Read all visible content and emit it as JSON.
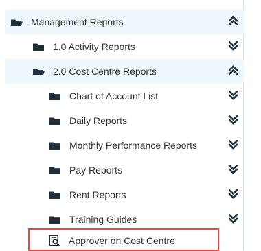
{
  "tree": {
    "root": {
      "label": "Management Reports",
      "expanded": true,
      "icon": "folder-open-icon"
    },
    "children": [
      {
        "label": "1.0 Activity Reports",
        "expanded": false,
        "icon": "folder-icon"
      },
      {
        "label": "2.0 Cost Centre Reports",
        "expanded": true,
        "icon": "folder-open-icon",
        "children": [
          {
            "label": "Chart of Account List",
            "icon": "folder-icon",
            "expanded": false
          },
          {
            "label": "Daily Reports",
            "icon": "folder-icon",
            "expanded": false
          },
          {
            "label": "Monthly Performance Reports",
            "icon": "folder-icon",
            "expanded": false
          },
          {
            "label": "Pay Reports",
            "icon": "folder-icon",
            "expanded": false
          },
          {
            "label": "Rent Reports",
            "icon": "folder-icon",
            "expanded": false
          },
          {
            "label": "Training Guides",
            "icon": "folder-icon",
            "expanded": false
          },
          {
            "label": "Approver on Cost Centre",
            "icon": "document-search-icon",
            "selected": true
          }
        ]
      }
    ]
  },
  "colors": {
    "text": "#333333",
    "icon": "#1f2f3a",
    "chevron": "#1f3341",
    "active_background": "#eef7fb",
    "selection_border": "#df4b45",
    "divider": "#d9e4ea"
  }
}
